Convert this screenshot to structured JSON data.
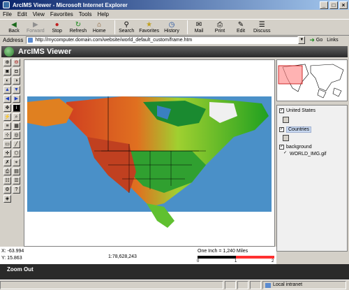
{
  "window": {
    "title": "ArcIMS Viewer - Microsoft Internet Explorer",
    "buttons": [
      "_",
      "□",
      "×"
    ]
  },
  "menu": [
    "File",
    "Edit",
    "View",
    "Favorites",
    "Tools",
    "Help"
  ],
  "toolbar": {
    "back": "Back",
    "forward": "Forward",
    "stop": "Stop",
    "refresh": "Refresh",
    "home": "Home",
    "search": "Search",
    "favorites": "Favorites",
    "history": "History",
    "mail": "Mail",
    "print": "Print",
    "edit": "Edit",
    "discuss": "Discuss"
  },
  "address": {
    "label": "Address",
    "url": "http://mycomputer.domain.com/website/world_default_custom/frame.htm",
    "go": "Go",
    "links": "Links"
  },
  "viewer": {
    "title": "ArcIMS Viewer"
  },
  "layers": {
    "united_states": "United States",
    "countries": "Countries",
    "background": "background",
    "world_img": "WORLD_IMG.gif"
  },
  "status": {
    "x": "X: -63.994",
    "y": "Y: 15.863",
    "scale": "1:78,628,243",
    "scalebar_label": "One Inch = 1,240 Miles",
    "scale_ticks": [
      "0",
      "1",
      "2"
    ]
  },
  "mode": "Zoom Out",
  "statusbar": {
    "zone": "Local intranet"
  },
  "colors": {
    "title_start": "#0a246a",
    "title_end": "#a6caf0",
    "header_dark": "#2a2a2a",
    "scalebar_red": "#ff3030"
  }
}
